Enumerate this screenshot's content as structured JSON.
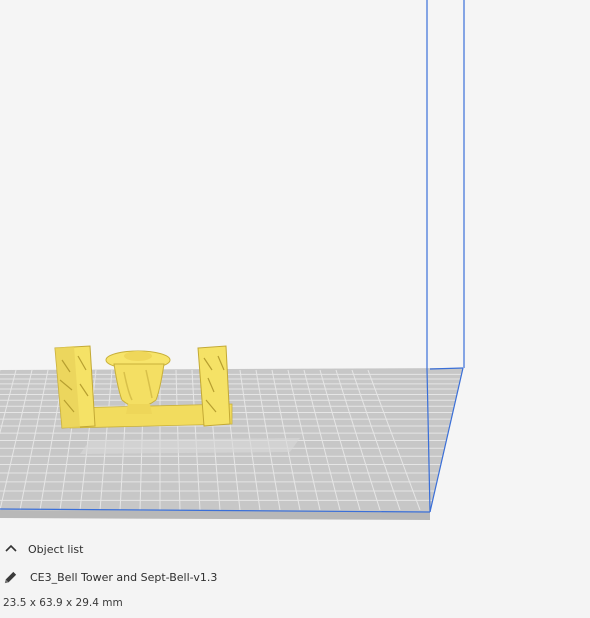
{
  "scene": {
    "build_volume_color": "#3a6fd8",
    "plate_color": "#c8c8c8",
    "grid_line_color": "#e3e3e3",
    "model_color": "#f7e36b",
    "model_shadow_color": "#c9b23c"
  },
  "object_panel": {
    "toggle_label": "Object list",
    "toggle_icon": "chevron-up-icon",
    "edit_icon": "pencil-icon",
    "object_name": "CE3_Bell Tower and Sept-Bell-v1.3",
    "dimensions": "23.5 x 63.9 x 29.4 mm"
  }
}
